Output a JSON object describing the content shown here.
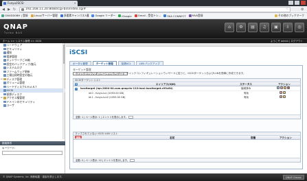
{
  "browser": {
    "tab_title": "Funyu/iSCSI",
    "url": "192.168.11.20:8080/cgi-bin/index.cgi#",
    "bookmarks": [
      "GNUDD0BH | 登録",
      "Linux/サーバー管理",
      "多要素キャンパス3通",
      "Google リーダー",
      "iGoogle",
      "Gmail - 受信トレ...",
      "SKA CONNECT",
      "MVA登録",
      "その他のブックマーク"
    ]
  },
  "header": {
    "logo": "QNAP",
    "logo_sub": "Turbo NAS",
    "breadcrumb": "ホーム >> システム管理 >> iSCSI",
    "welcome": "ようこそ admin | ログアウト"
  },
  "sidebar": {
    "items": [
      {
        "label": "ハードウェア",
        "level": 1
      },
      {
        "label": "セキュリティ",
        "level": 1
      },
      {
        "label": "通知",
        "level": 1
      },
      {
        "label": "電源管理",
        "level": 1
      },
      {
        "label": "ネットワークごみ箱",
        "level": 1
      },
      {
        "label": "設定のバックアップ/復元",
        "level": 1
      },
      {
        "label": "システムログ",
        "level": 1
      },
      {
        "label": "ファームウェア更新",
        "level": 1
      },
      {
        "label": "工場出荷時設定の復元",
        "level": 1
      },
      {
        "label": "ディスク管理",
        "level": 0
      },
      {
        "label": "ボリューム管理",
        "level": 1
      },
      {
        "label": "ハードディスクS.M.A.R.T",
        "level": 1
      },
      {
        "label": "iSCSI",
        "level": 1,
        "selected": true
      },
      {
        "label": "仮想ディスク",
        "level": 1
      },
      {
        "label": "アクセス権管理",
        "level": 0
      },
      {
        "label": "ドメインのセキュリティ",
        "level": 1
      },
      {
        "label": "ユーザ",
        "level": 1
      }
    ],
    "search_title": "検索条件",
    "search_label": "キーワード:",
    "search_value": ""
  },
  "main": {
    "title": "iSCSI",
    "tabs": [
      "ポータル管理",
      "ターゲット管理",
      "拡張ACL",
      "LUN バックアップ"
    ],
    "active_tab": 1,
    "section_title": "ターゲット管理",
    "wizard_button": "クイックコンフィギュレーションウィザード",
    "wizard_desc": "クイックコンフィギュレーションウィザードに従うと、iSCSIターゲットおよびLUNを簡単に作成できます。",
    "target_list": {
      "title": "iSCSIターゲットリスト",
      "columns": [
        "エイリアス(IQN)",
        "ステータス",
        "アクション"
      ],
      "target": {
        "name": "iscsitarget (iqn.2004-04.com.qnap:ts-112:iscsi.iscsitarget.c93c64)",
        "status": "接続済み"
      },
      "luns": [
        {
          "name": "id:0 - funyu-lun (1093.00 GB)",
          "status": "有効"
        },
        {
          "name": "id:1 - funyu-lun2 (1093.00 GB)",
          "status": "有効"
        }
      ],
      "pager": "全数: 1 | ページ表示: 1 | エントリを表示します。"
    },
    "unmapped_list": {
      "title": "マップされていない iSCSI LUN リスト",
      "delete_button": "削除",
      "columns": [
        "名前",
        "容量",
        "アクション"
      ],
      "pager": "全数: 0 | ページ表示: 10 | エントリを表示します。"
    }
  },
  "status": {
    "copyright": "© QNAP Systems, Inc. 無断転載・複製を禁止します。",
    "classic_button": "QNAP Classic"
  }
}
